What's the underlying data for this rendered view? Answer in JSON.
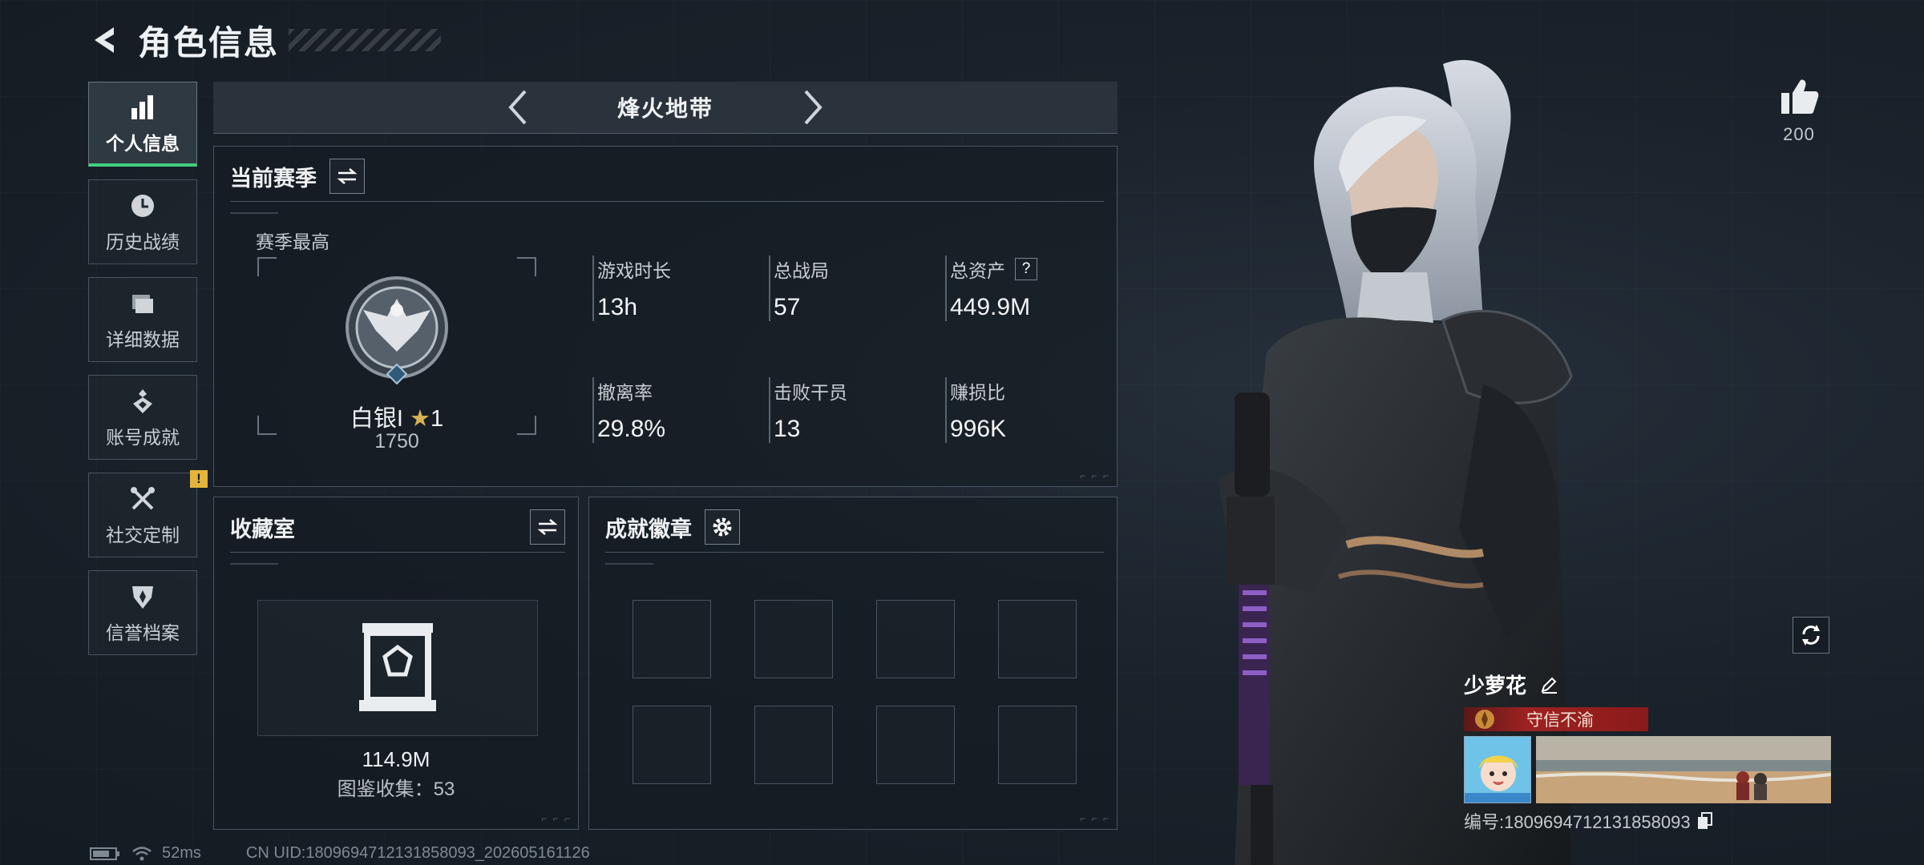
{
  "header": {
    "title": "角色信息"
  },
  "sidebar": {
    "items": [
      {
        "label": "个人信息",
        "icon": "bar-chart-icon",
        "active": true
      },
      {
        "label": "历史战绩",
        "icon": "history-clock-icon"
      },
      {
        "label": "详细数据",
        "icon": "folder-icon"
      },
      {
        "label": "账号成就",
        "icon": "achievement-medal-icon"
      },
      {
        "label": "社交定制",
        "icon": "tools-icon",
        "badge": "!"
      },
      {
        "label": "信誉档案",
        "icon": "credit-shield-icon"
      }
    ]
  },
  "mode": {
    "title": "烽火地带"
  },
  "season": {
    "title": "当前赛季",
    "subtitle": "赛季最高",
    "rank_name": "白银I",
    "rank_stars": "1",
    "rank_score": "1750",
    "stats": [
      {
        "label": "游戏时长",
        "value": "13h"
      },
      {
        "label": "总战局",
        "value": "57"
      },
      {
        "label": "总资产",
        "value": "449.9M",
        "help": "?"
      },
      {
        "label": "撤离率",
        "value": "29.8%"
      },
      {
        "label": "击败干员",
        "value": "13"
      },
      {
        "label": "赚损比",
        "value": "996K"
      }
    ]
  },
  "collection": {
    "title": "收藏室",
    "value": "114.9M",
    "count_text": "图鉴收集：53"
  },
  "badges": {
    "title": "成就徽章",
    "slots": 8
  },
  "likes": {
    "count": "200"
  },
  "profile": {
    "name": "少萝花",
    "honor": "守信不渝",
    "uid_text": "编号:1809694712131858093"
  },
  "footer": {
    "ping": "52ms",
    "cn_uid": "CN UID:1809694712131858093_202605161126"
  },
  "colors": {
    "accent_green": "#3fd07f",
    "honor_red": "#9e2222",
    "badge_yellow": "#e4b53a"
  }
}
